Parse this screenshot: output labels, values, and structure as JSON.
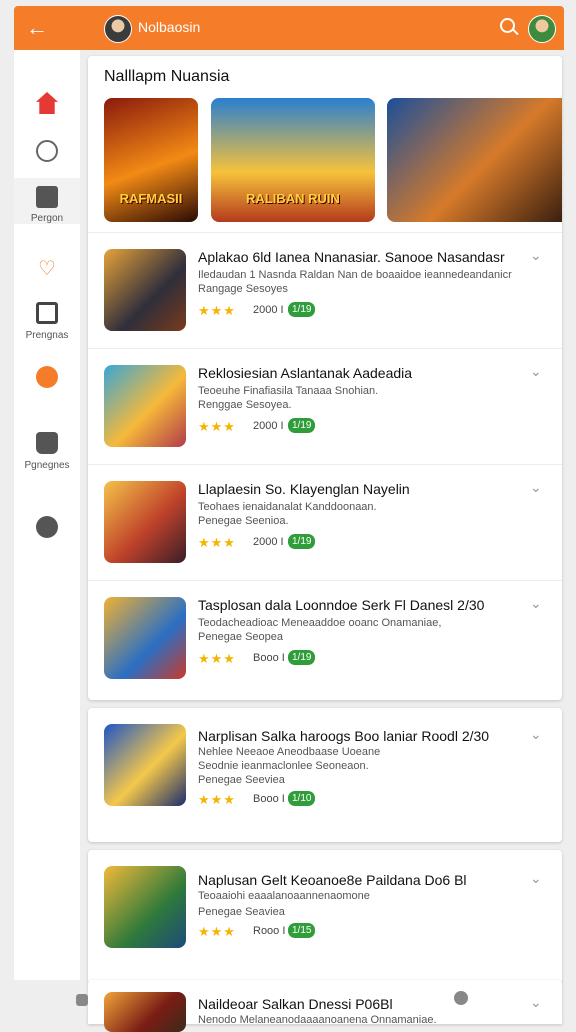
{
  "header": {
    "title": "Nolbaosin",
    "back_icon": "arrow-left-icon",
    "search_icon": "search-icon",
    "accent_color": "#f57c28"
  },
  "sidebar": {
    "items": [
      {
        "icon": "home-icon",
        "label": ""
      },
      {
        "icon": "chat-icon",
        "label": ""
      },
      {
        "icon": "edit-icon",
        "label": "Pergon"
      },
      {
        "icon": "heart-icon",
        "label": ""
      },
      {
        "icon": "inbox-icon",
        "label": "Prengnas"
      },
      {
        "icon": "fire-icon",
        "label": ""
      },
      {
        "icon": "bag-icon",
        "label": "Pgnegnes"
      },
      {
        "icon": "compass-icon",
        "label": ""
      }
    ]
  },
  "featured": {
    "title": "Nalllapm Nuansia",
    "banners": [
      {
        "text": "RAFMASII"
      },
      {
        "text": "RALIBAN RUIN"
      },
      {
        "text": ""
      }
    ]
  },
  "apps": [
    {
      "title": "Aplakao 6ld Ianea Nnanasiar. Sanooe Nasandasr",
      "sub1": "Iledaudan 1 Nasnda Raldan Nan de boaaidoe ieannedeandanicr",
      "sub2": "Rangage Sesoyes",
      "stars": "★★★",
      "count": "2000 I",
      "badge": "1/19"
    },
    {
      "title": "Reklosiesian Aslantanak Aadeadia",
      "sub1": "Teoeuhe Finafiasila Tanaaa Snohian.",
      "sub2": "Renggae Sesoyea.",
      "stars": "★★★",
      "count": "2000 I",
      "badge": "1/19"
    },
    {
      "title": "Llaplaesin So. Klayenglan Nayelin",
      "sub1": "Teohaes ienaidanalat Kanddoonaan.",
      "sub2": "Penegae Seenioa.",
      "stars": "★★★",
      "count": "2000 I",
      "badge": "1/19"
    },
    {
      "title": "Tasplosan dala Loonndoe Serk Fl Danesl 2/30",
      "sub1": "Teodacheadioac Meneaaddoe ooanc Onamaniae,",
      "sub2": "Penegae Seopea",
      "stars": "★★★",
      "count": "Booo I",
      "badge": "1/19"
    },
    {
      "title": "Narplisan Salka haroogs Boo laniar Roodl 2/30",
      "sub1": "Nehlee Neeaoe Aneodbaase Uoeane",
      "sub2": "Seodnie ieanmaclonlee Seoneaon.",
      "sub3": "Penegae Seeviea",
      "stars": "★★★",
      "count": "Booo I",
      "badge": "1/10"
    },
    {
      "title": "Naplusan Gelt Keoanoe8e Paildana Do6 Bl",
      "sub1": "Teoaaiohi eaaalanoaannenaomone",
      "sub2": "Penegae Seaviea",
      "stars": "★★★",
      "count": "Rooo I",
      "badge": "1/15"
    },
    {
      "title": "Naildeoar Salkan Dnessi P06Bl",
      "sub1": "Nenodo Melaneanodaaaanoanena Onnamaniae.",
      "stars": "",
      "count": "",
      "badge": ""
    }
  ]
}
